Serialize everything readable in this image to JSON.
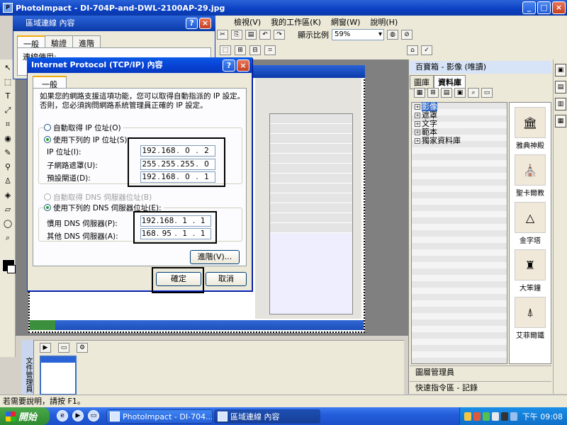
{
  "app": {
    "title": "PhotoImpact - DI-704P-and-DWL-2100AP-29.jpg",
    "menu": [
      "檢視(V)",
      "我的工作區(K)",
      "網窗(W)",
      "說明(H)"
    ],
    "zoom_label": "顯示比例",
    "zoom_value": "59%",
    "status": "若需要說明，請按 F1。",
    "lower_panel_tab": "文件管理員"
  },
  "right_panel": {
    "title": "百寶箱 - 影像 (唯讀)",
    "tabs": [
      "圖庫",
      "資料庫"
    ],
    "tree": [
      "影像",
      "遮罩",
      "文字",
      "範本",
      "獨家資料庫"
    ],
    "gallery": [
      "雅典神殿",
      "聖卡爾教",
      "金字塔",
      "大笨鐘",
      "艾菲爾鐵"
    ],
    "footer1": "圖層管理員",
    "footer2": "快速指令區 - 記錄"
  },
  "lan_dialog": {
    "title": "區域連線 內容",
    "tabs": [
      "一般",
      "驗證",
      "進階"
    ],
    "conn_label": "連線使用:"
  },
  "tcp_dialog": {
    "title": "Internet Protocol (TCP/IP) 內容",
    "tab": "一般",
    "description": "如果您的網路支援這項功能，您可以取得自動指派的 IP 設定。否則，您必須詢問網路系統管理員正確的 IP 設定。",
    "auto_ip": "自動取得 IP 位址(O)",
    "manual_ip": "使用下列的 IP 位址(S):",
    "ip_label": "IP 位址(I):",
    "ip_value": [
      "192",
      "168",
      "0",
      "2"
    ],
    "mask_label": "子網路遮罩(U):",
    "mask_value": [
      "255",
      "255",
      "255",
      "0"
    ],
    "gateway_label": "預設閘道(D):",
    "gateway_value": [
      "192",
      "168",
      "0",
      "1"
    ],
    "auto_dns": "自動取得 DNS 伺服器位址(B)",
    "manual_dns": "使用下列的 DNS 伺服器位址(E):",
    "dns1_label": "慣用 DNS 伺服器(P):",
    "dns1_value": [
      "192",
      "168",
      "1",
      "1"
    ],
    "dns2_label": "其他 DNS 伺服器(A):",
    "dns2_value": [
      "168",
      "95",
      "1",
      "1"
    ],
    "advanced_button": "進階(V)...",
    "ok_button": "確定",
    "cancel_button": "取消"
  },
  "taskbar": {
    "start": "開始",
    "tasks": [
      "PhotoImpact - DI-704...",
      "區域連線 內容"
    ],
    "clock": "下午 09:08"
  }
}
